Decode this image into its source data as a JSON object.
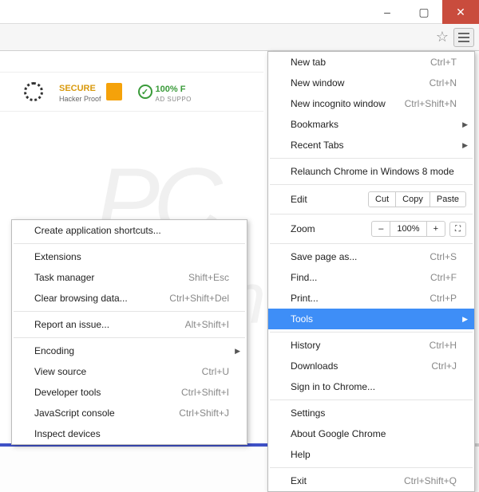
{
  "window": {
    "min": "–",
    "max": "▢",
    "close": "✕"
  },
  "toolbar": {
    "star": "☆"
  },
  "banner": {
    "secure_title": "SECURE",
    "secure_sub": "Hacker Proof",
    "supp_check": "✓",
    "supp_title": "100% F",
    "supp_sub": "AD SUPPO"
  },
  "menu": {
    "newtab": {
      "label": "New tab",
      "key": "Ctrl+T"
    },
    "newwin": {
      "label": "New window",
      "key": "Ctrl+N"
    },
    "incog": {
      "label": "New incognito window",
      "key": "Ctrl+Shift+N"
    },
    "bookmarks": {
      "label": "Bookmarks"
    },
    "recent": {
      "label": "Recent Tabs"
    },
    "relaunch": {
      "label": "Relaunch Chrome in Windows 8 mode"
    },
    "edit": {
      "label": "Edit",
      "cut": "Cut",
      "copy": "Copy",
      "paste": "Paste"
    },
    "zoom": {
      "label": "Zoom",
      "minus": "–",
      "value": "100%",
      "plus": "+",
      "fs": "⛶"
    },
    "saveas": {
      "label": "Save page as...",
      "key": "Ctrl+S"
    },
    "find": {
      "label": "Find...",
      "key": "Ctrl+F"
    },
    "print": {
      "label": "Print...",
      "key": "Ctrl+P"
    },
    "tools": {
      "label": "Tools"
    },
    "history": {
      "label": "History",
      "key": "Ctrl+H"
    },
    "downloads": {
      "label": "Downloads",
      "key": "Ctrl+J"
    },
    "signin": {
      "label": "Sign in to Chrome..."
    },
    "settings": {
      "label": "Settings"
    },
    "about": {
      "label": "About Google Chrome"
    },
    "help": {
      "label": "Help"
    },
    "exit": {
      "label": "Exit",
      "key": "Ctrl+Shift+Q"
    }
  },
  "sub": {
    "shortcuts": {
      "label": "Create application shortcuts..."
    },
    "extensions": {
      "label": "Extensions"
    },
    "taskmgr": {
      "label": "Task manager",
      "key": "Shift+Esc"
    },
    "clear": {
      "label": "Clear browsing data...",
      "key": "Ctrl+Shift+Del"
    },
    "report": {
      "label": "Report an issue...",
      "key": "Alt+Shift+I"
    },
    "encoding": {
      "label": "Encoding"
    },
    "viewsrc": {
      "label": "View source",
      "key": "Ctrl+U"
    },
    "devtools": {
      "label": "Developer tools",
      "key": "Ctrl+Shift+I"
    },
    "jsconsole": {
      "label": "JavaScript console",
      "key": "Ctrl+Shift+J"
    },
    "inspect": {
      "label": "Inspect devices"
    }
  },
  "watermark1": "PC",
  "watermark2": "risk.com"
}
